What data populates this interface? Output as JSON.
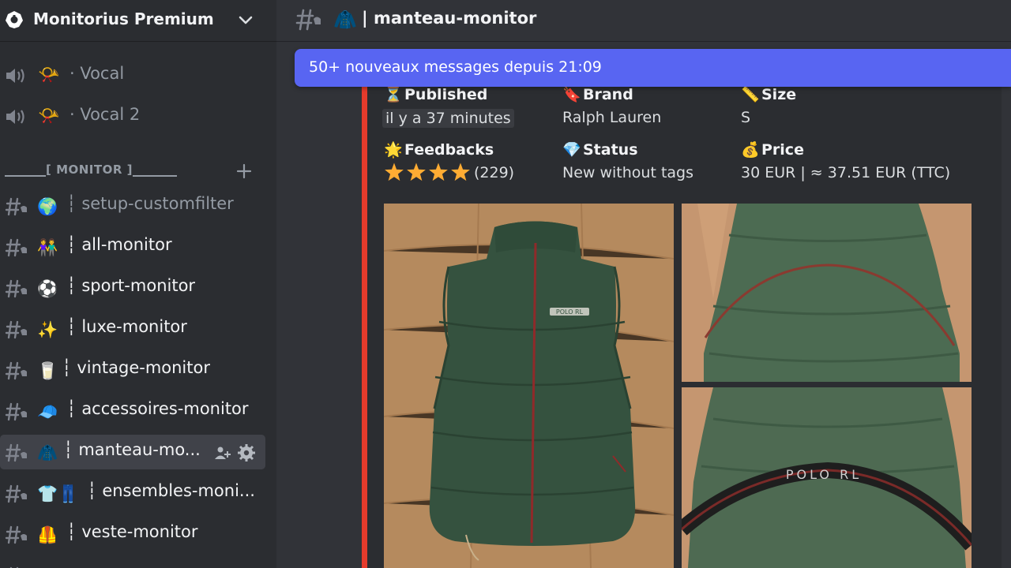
{
  "server": {
    "name": "Monitorius Premium"
  },
  "voice_channels": [
    {
      "emoji": "📯",
      "name": "· Vocal"
    },
    {
      "emoji": "📯",
      "name": "· Vocal 2"
    }
  ],
  "category": {
    "label": "[ MONITOR ]"
  },
  "channels": [
    {
      "emoji": "🌍",
      "name": "┆ setup-customfilter",
      "dim": true
    },
    {
      "emoji": "👫",
      "name": "┆ all-monitor"
    },
    {
      "emoji": "⚽",
      "name": "┆ sport-monitor"
    },
    {
      "emoji": "✨",
      "name": "┆ luxe-monitor"
    },
    {
      "emoji": "🥛",
      "name": "┆ vintage-monitor"
    },
    {
      "emoji": "🧢",
      "name": "┆ accessoires-monitor"
    },
    {
      "emoji": "🧥",
      "name": "┆ manteau-mo...",
      "active": true
    },
    {
      "emoji": "👕👖",
      "name": "┆ ensembles-moni..."
    },
    {
      "emoji": "🦺",
      "name": "┆ veste-monitor"
    }
  ],
  "header": {
    "emoji": "🧥",
    "title": "| manteau-monitor"
  },
  "banner": {
    "text": "50+ nouveaux messages depuis 21:09"
  },
  "embed": {
    "accent_color": "#e53b2c",
    "fields": {
      "published": {
        "emoji": "⏳",
        "label": "Published",
        "value": "il y a 37 minutes"
      },
      "brand": {
        "emoji": "🔖",
        "label": "Brand",
        "value": "Ralph Lauren"
      },
      "size": {
        "emoji": "📏",
        "label": "Size",
        "value": "S"
      },
      "feedbacks": {
        "emoji": "🌟",
        "label": "Feedbacks",
        "rating": 4,
        "count": "(229)"
      },
      "status": {
        "emoji": "💎",
        "label": "Status",
        "value": "New without tags"
      },
      "price": {
        "emoji": "💰",
        "label": "Price",
        "value": "30 EUR | ≈ 37.51 EUR (TTC)"
      }
    },
    "photos": [
      {
        "name": "photo-front",
        "label": "POLO RL"
      },
      {
        "name": "photo-back-top",
        "label": ""
      },
      {
        "name": "photo-back-collar",
        "label": "POLO RL"
      }
    ]
  }
}
